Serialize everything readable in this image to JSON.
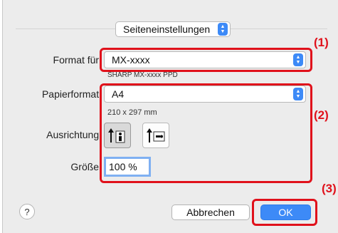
{
  "dialog": {
    "settings_popup": "Seiteneinstellungen",
    "format_label": "Format für:",
    "format_value": "MX-xxxx",
    "format_subtitle": "SHARP MX-xxxx PPD",
    "paper_label": "Papierformat:",
    "paper_value": "A4",
    "paper_dimensions": "210 x 297 mm",
    "orientation_label": "Ausrichtung:",
    "orientation_options": [
      "portrait",
      "landscape"
    ],
    "orientation_selected": "portrait",
    "scale_label": "Größe:",
    "scale_value": "100 %",
    "help_label": "?",
    "cancel_label": "Abbrechen",
    "ok_label": "OK"
  },
  "callouts": {
    "one": "(1)",
    "two": "(2)",
    "three": "(3)"
  },
  "colors": {
    "highlight": "#e0111b",
    "accent": "#3d8af7"
  }
}
